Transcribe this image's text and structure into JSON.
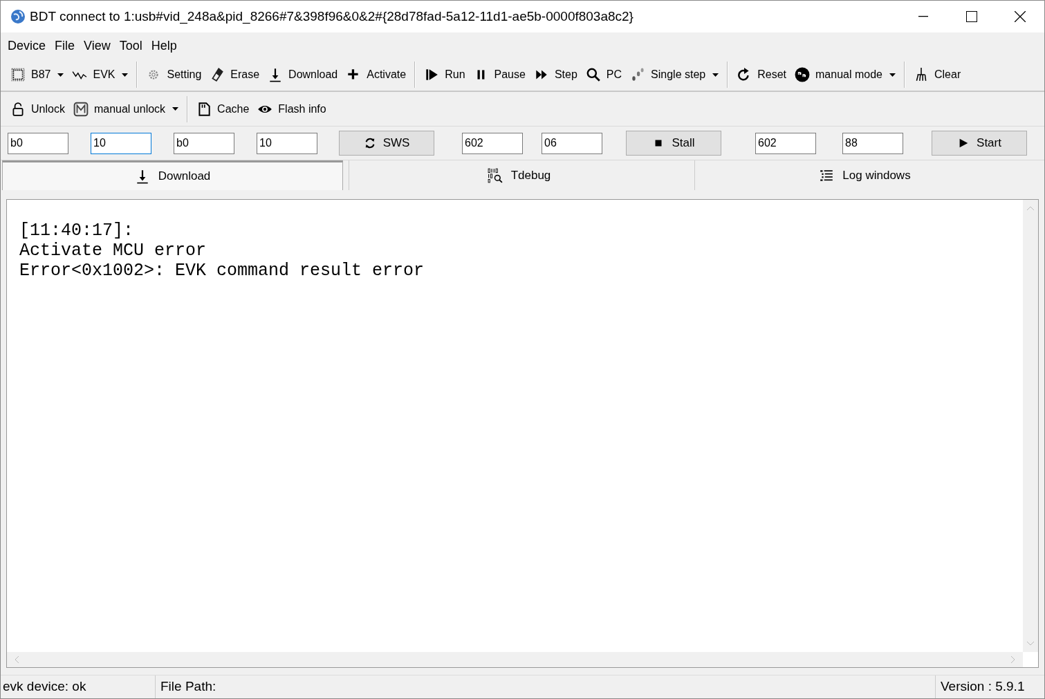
{
  "window": {
    "title": "BDT connect to 1:usb#vid_248a&pid_8266#7&398f96&0&2#{28d78fad-5a12-11d1-ae5b-0000f803a8c2}"
  },
  "menu": [
    "Device",
    "File",
    "View",
    "Tool",
    "Help"
  ],
  "toolbar_1": [
    [
      {
        "label": "B87",
        "dropdown": true
      },
      {
        "label": "EVK",
        "dropdown": true
      }
    ],
    [
      {
        "label": "Setting",
        "dropdown": false
      },
      {
        "label": "Erase",
        "dropdown": false
      },
      {
        "label": "Download",
        "dropdown": false
      },
      {
        "label": "Activate",
        "dropdown": false
      }
    ],
    [
      {
        "label": "Run",
        "dropdown": false
      },
      {
        "label": "Pause",
        "dropdown": false
      },
      {
        "label": "Step",
        "dropdown": false
      },
      {
        "label": "PC",
        "dropdown": false
      },
      {
        "label": "Single step",
        "dropdown": true
      }
    ],
    [
      {
        "label": "Reset",
        "dropdown": false
      },
      {
        "label": "manual mode",
        "dropdown": true
      }
    ],
    [
      {
        "label": "Clear",
        "dropdown": false
      }
    ]
  ],
  "toolbar_2": [
    [
      {
        "label": "Unlock",
        "dropdown": false
      },
      {
        "label": "manual unlock",
        "dropdown": true
      }
    ],
    [
      {
        "label": "Cache",
        "dropdown": false
      },
      {
        "label": "Flash info",
        "dropdown": false
      }
    ]
  ],
  "controls": [
    {
      "kind": "field",
      "value": "b0",
      "focused": false
    },
    {
      "kind": "field",
      "value": "10",
      "focused": true
    },
    {
      "kind": "field",
      "value": "b0",
      "focused": false
    },
    {
      "kind": "field",
      "value": "10",
      "focused": false
    },
    {
      "kind": "button",
      "label": "SWS"
    },
    {
      "kind": "field",
      "value": "602",
      "focused": false
    },
    {
      "kind": "field",
      "value": "06",
      "focused": false
    },
    {
      "kind": "button",
      "label": "Stall"
    },
    {
      "kind": "field",
      "value": "602",
      "focused": false
    },
    {
      "kind": "field",
      "value": "88",
      "focused": false
    },
    {
      "kind": "button",
      "label": "Start"
    }
  ],
  "tabs": [
    {
      "label": "Download",
      "selected": true
    },
    {
      "label": "Tdebug",
      "selected": false
    },
    {
      "label": "Log windows",
      "selected": false
    }
  ],
  "log": [
    "[11:40:17]:",
    "Activate MCU error",
    "Error<0x1002>: EVK command result error"
  ],
  "status_bar": {
    "device": "evk device: ok",
    "file_path": "File Path:",
    "version": "Version : 5.9.1"
  }
}
